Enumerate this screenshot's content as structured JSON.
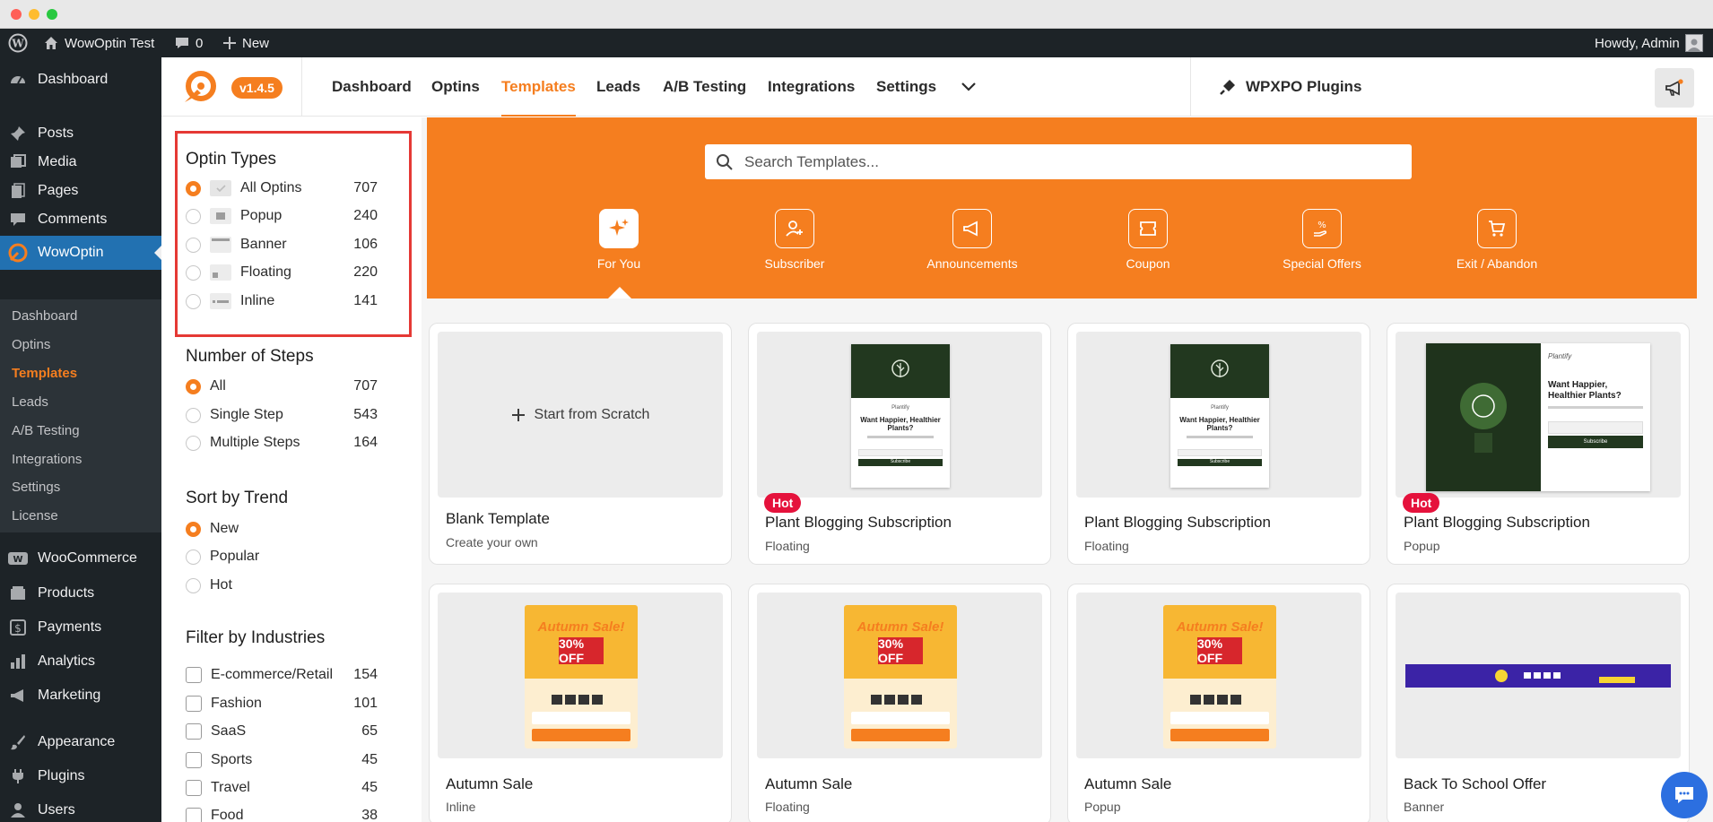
{
  "adminbar": {
    "site_name": "WowOptin Test",
    "comments_count": "0",
    "new_label": "New",
    "howdy": "Howdy, Admin"
  },
  "wp_menu": {
    "dashboard": "Dashboard",
    "posts": "Posts",
    "media": "Media",
    "pages": "Pages",
    "comments": "Comments",
    "wowoptin": "WowOptin",
    "submenu": [
      "Dashboard",
      "Optins",
      "Templates",
      "Leads",
      "A/B Testing",
      "Integrations",
      "Settings",
      "License"
    ],
    "woocommerce": "WooCommerce",
    "products": "Products",
    "payments": "Payments",
    "analytics": "Analytics",
    "marketing": "Marketing",
    "appearance": "Appearance",
    "plugins": "Plugins",
    "users": "Users"
  },
  "plugin_header": {
    "version": "v1.4.5",
    "nav": [
      "Dashboard",
      "Optins",
      "Templates",
      "Leads",
      "A/B Testing",
      "Integrations",
      "Settings"
    ],
    "active_nav": "Templates",
    "wpxpo": "WPXPO Plugins",
    "accent": "#f57e1f"
  },
  "filters": {
    "optin_types": {
      "title": "Optin Types",
      "items": [
        {
          "label": "All Optins",
          "count": "707",
          "selected": true
        },
        {
          "label": "Popup",
          "count": "240"
        },
        {
          "label": "Banner",
          "count": "106"
        },
        {
          "label": "Floating",
          "count": "220"
        },
        {
          "label": "Inline",
          "count": "141"
        }
      ]
    },
    "steps": {
      "title": "Number of Steps",
      "items": [
        {
          "label": "All",
          "count": "707",
          "selected": true
        },
        {
          "label": "Single Step",
          "count": "543"
        },
        {
          "label": "Multiple Steps",
          "count": "164"
        }
      ]
    },
    "trend": {
      "title": "Sort by Trend",
      "items": [
        {
          "label": "New",
          "selected": true
        },
        {
          "label": "Popular"
        },
        {
          "label": "Hot"
        }
      ]
    },
    "industries": {
      "title": "Filter by Industries",
      "items": [
        {
          "label": "E-commerce/Retail",
          "count": "154"
        },
        {
          "label": "Fashion",
          "count": "101"
        },
        {
          "label": "SaaS",
          "count": "65"
        },
        {
          "label": "Sports",
          "count": "45"
        },
        {
          "label": "Travel",
          "count": "45"
        },
        {
          "label": "Food",
          "count": "38"
        }
      ]
    }
  },
  "search": {
    "placeholder": "Search Templates..."
  },
  "categories": [
    "For You",
    "Subscriber",
    "Announcements",
    "Coupon",
    "Special Offers",
    "Exit / Abandon"
  ],
  "templates": [
    {
      "title": "Blank Template",
      "sub": "Create your own",
      "thumb_text": "Start from Scratch"
    },
    {
      "title": "Plant Blogging Subscription",
      "sub": "Floating",
      "badge": "Hot"
    },
    {
      "title": "Plant Blogging Subscription",
      "sub": "Floating"
    },
    {
      "title": "Plant Blogging Subscription",
      "sub": "Popup",
      "badge": "Hot"
    },
    {
      "title": "Autumn Sale",
      "sub": "Inline"
    },
    {
      "title": "Autumn Sale",
      "sub": "Floating"
    },
    {
      "title": "Autumn Sale",
      "sub": "Popup"
    },
    {
      "title": "Back To School Offer",
      "sub": "Banner"
    }
  ],
  "thumbs": {
    "plant_headline": "Want Happier, Healthier Plants?",
    "plant_button": "Subscribe",
    "plant_brand": "Plantify",
    "autumn_title": "Autumn Sale!",
    "autumn_pct": "30% OFF"
  }
}
